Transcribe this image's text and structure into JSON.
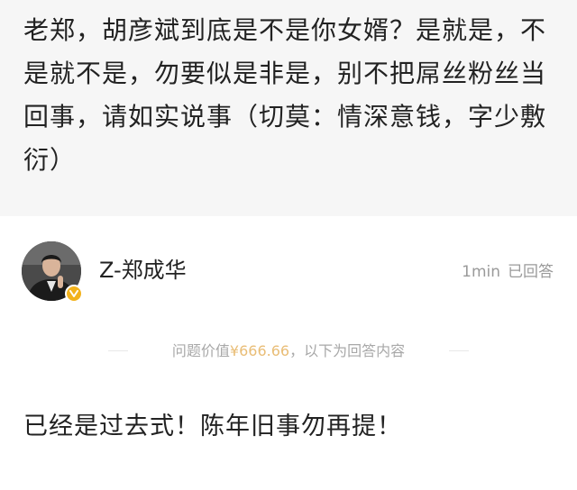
{
  "question": {
    "text": "老郑，胡彦斌到底是不是你女婿？是就是，不是就不是，勿要似是非是，别不把屌丝粉丝当回事，请如实说事（切莫：情深意钱，字少敷衍）"
  },
  "answer": {
    "answerer_name": "Z-郑成华",
    "time": "1min",
    "status": "已回答",
    "price_prefix": "问题价值",
    "price_value": "¥666.66",
    "price_suffix": "，以下为回答内容",
    "text": "已经是过去式！陈年旧事勿再提！"
  },
  "colors": {
    "question_bg": "#f6f6f6",
    "price_accent": "#e9bd76",
    "badge": "#f2b21c",
    "muted_text": "#9a9a9a"
  },
  "icons": {
    "avatar": "user-avatar-photo",
    "badge": "verified-badge-icon"
  }
}
